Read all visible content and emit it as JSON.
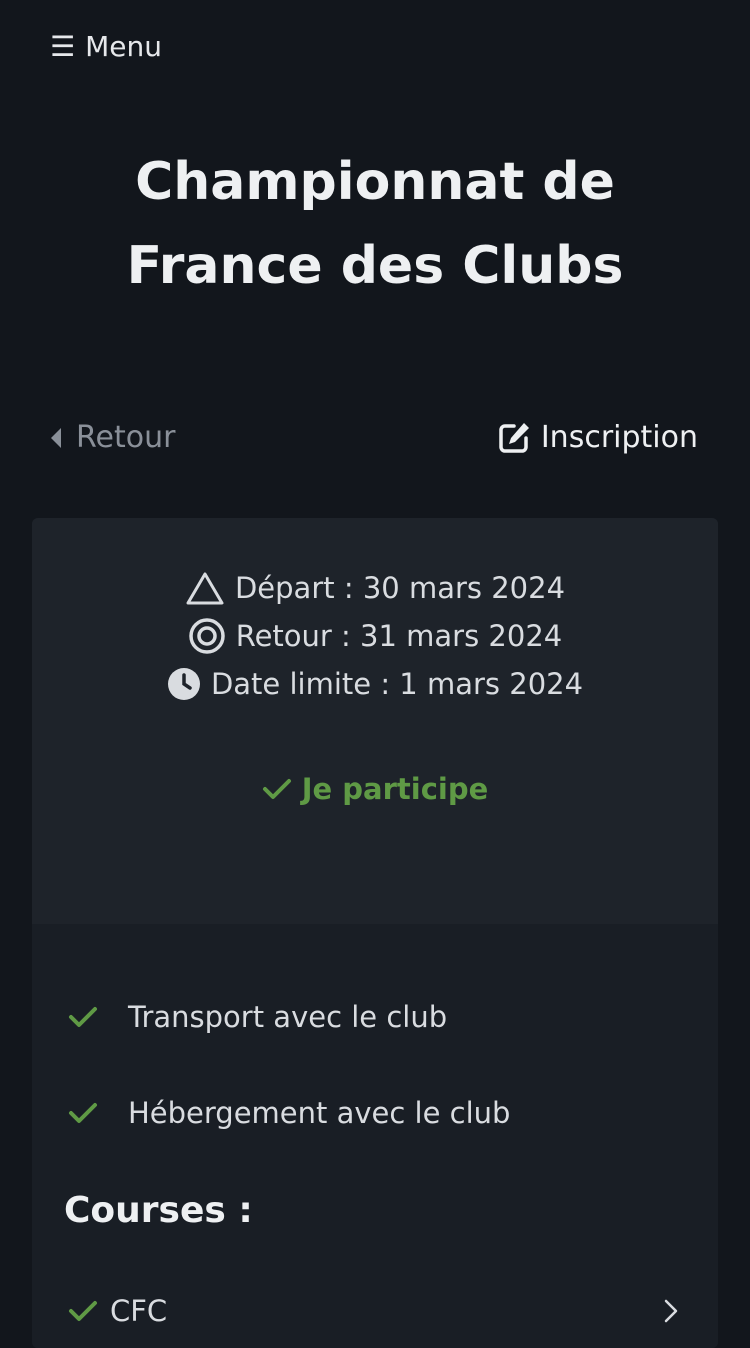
{
  "menu": {
    "label": "Menu",
    "icon": "hamburger-icon",
    "glyph": "☰"
  },
  "event": {
    "title": "Championnat de France des Clubs"
  },
  "nav": {
    "back_label": "Retour",
    "back_icon": "caret-left-icon",
    "signup_label": "Inscription",
    "signup_icon": "edit-icon"
  },
  "dates": {
    "departure": "Départ : 30 mars 2024",
    "return": "Retour : 31 mars 2024",
    "deadline": "Date limite : 1 mars 2024"
  },
  "status": {
    "label": "Je participe",
    "color": "#5f9a45"
  },
  "options": [
    {
      "label": "Transport avec le club",
      "icon": "check-icon"
    },
    {
      "label": "Hébergement avec le club",
      "icon": "check-icon"
    }
  ],
  "courses": {
    "heading": "Courses :",
    "items": [
      {
        "label": "CFC",
        "icon": "check-icon"
      }
    ]
  },
  "colors": {
    "background": "#12161c",
    "card": "#1e232a",
    "accent_green": "#5f9a45",
    "muted": "#8a9099"
  }
}
